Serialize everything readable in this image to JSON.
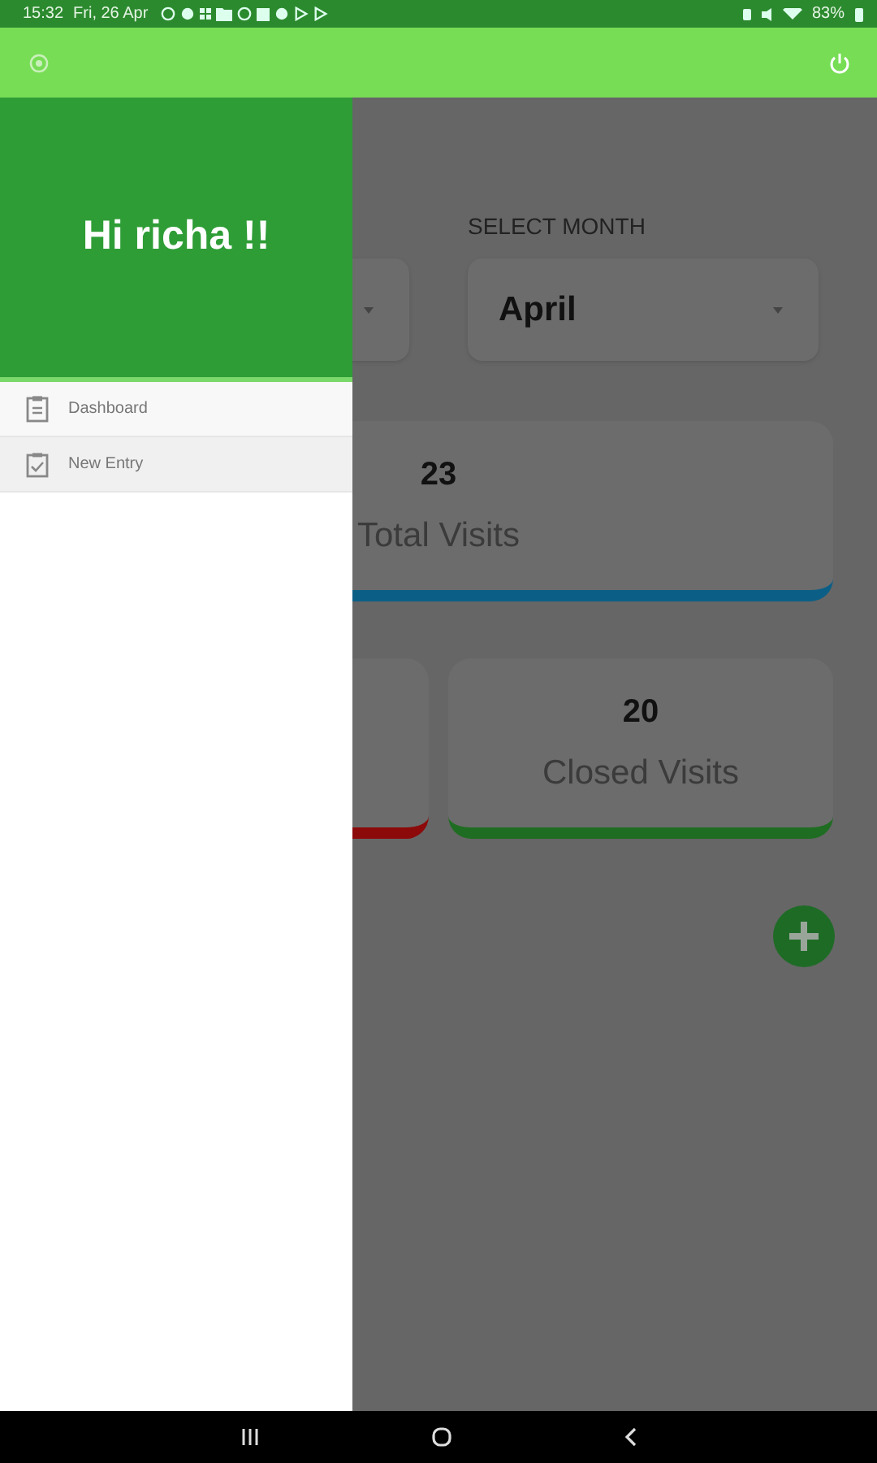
{
  "status_bar": {
    "time": "15:32",
    "date": "Fri, 26 Apr",
    "battery": "83%"
  },
  "drawer": {
    "greeting": "Hi richa !!",
    "items": [
      {
        "label": "Dashboard",
        "kind": "clipboard"
      },
      {
        "label": "New Entry",
        "kind": "checkbox"
      }
    ]
  },
  "month_select": {
    "label": "SELECT MONTH",
    "value": "April"
  },
  "cards": [
    {
      "value": "23",
      "label": "Total Visits",
      "color": "#0b5f86",
      "wide": true
    },
    {
      "color": "#8c0a0a",
      "wide": false
    },
    {
      "value": "20",
      "label": "Closed Visits",
      "color": "#1f6d22",
      "wide": false
    }
  ]
}
